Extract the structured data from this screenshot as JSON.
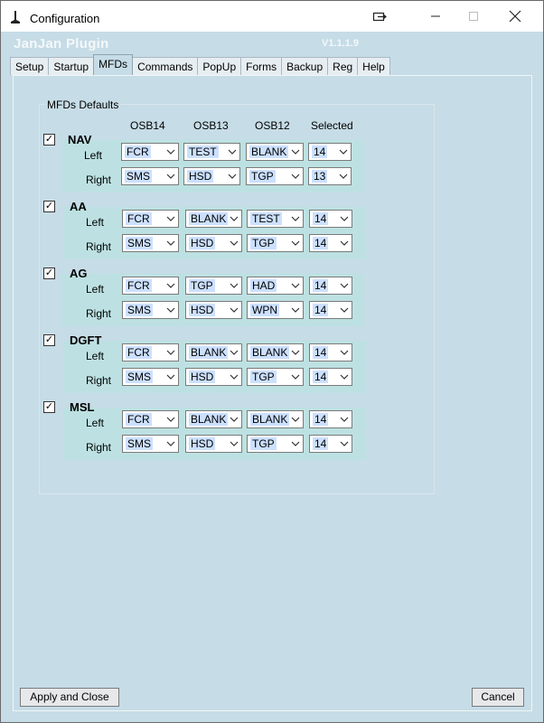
{
  "window": {
    "title": "Configuration"
  },
  "banner": {
    "title": "JanJan Plugin",
    "version": "V1.1.1.9"
  },
  "tabs": [
    {
      "label": "Setup"
    },
    {
      "label": "Startup"
    },
    {
      "label": "MFDs",
      "active": true
    },
    {
      "label": "Commands"
    },
    {
      "label": "PopUp"
    },
    {
      "label": "Forms"
    },
    {
      "label": "Backup"
    },
    {
      "label": "Reg"
    },
    {
      "label": "Help"
    }
  ],
  "group": {
    "label": "MFDs Defaults"
  },
  "columns": [
    "OSB14",
    "OSB13",
    "OSB12",
    "Selected"
  ],
  "row_labels": {
    "left": "Left",
    "right": "Right"
  },
  "sections": [
    {
      "name": "NAV",
      "checked": true,
      "left": [
        "FCR",
        "TEST",
        "BLANK",
        "14"
      ],
      "right": [
        "SMS",
        "HSD",
        "TGP",
        "13"
      ]
    },
    {
      "name": "AA",
      "checked": true,
      "left": [
        "FCR",
        "BLANK",
        "TEST",
        "14"
      ],
      "right": [
        "SMS",
        "HSD",
        "TGP",
        "14"
      ]
    },
    {
      "name": "AG",
      "checked": true,
      "left": [
        "FCR",
        "TGP",
        "HAD",
        "14"
      ],
      "right": [
        "SMS",
        "HSD",
        "WPN",
        "14"
      ]
    },
    {
      "name": "DGFT",
      "checked": true,
      "left": [
        "FCR",
        "BLANK",
        "BLANK",
        "14"
      ],
      "right": [
        "SMS",
        "HSD",
        "TGP",
        "14"
      ]
    },
    {
      "name": "MSL",
      "checked": true,
      "left": [
        "FCR",
        "BLANK",
        "BLANK",
        "14"
      ],
      "right": [
        "SMS",
        "HSD",
        "TGP",
        "14"
      ]
    }
  ],
  "buttons": {
    "apply": "Apply and Close",
    "cancel": "Cancel"
  },
  "check_mark": "✓",
  "colors": {
    "background": "#c6dce6",
    "section": "#bde1e2",
    "selection": "#cce0ff"
  }
}
